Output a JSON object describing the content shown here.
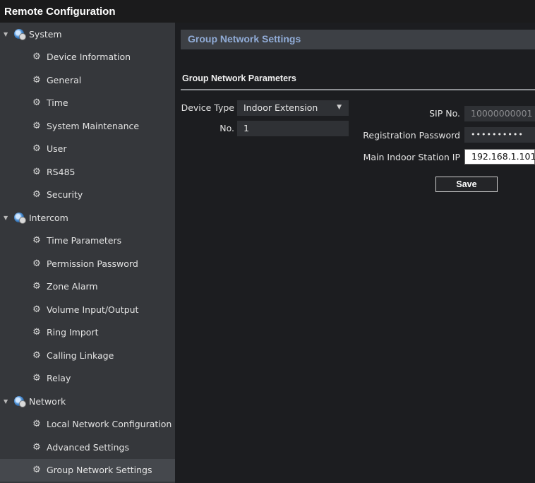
{
  "window": {
    "title": "Remote Configuration"
  },
  "sidebar": {
    "items": [
      {
        "kind": "group",
        "label": "System",
        "icon": "globe-settings-icon"
      },
      {
        "kind": "child",
        "label": "Device Information",
        "icon": "gear-icon"
      },
      {
        "kind": "child",
        "label": "General",
        "icon": "gear-icon"
      },
      {
        "kind": "child",
        "label": "Time",
        "icon": "gear-icon"
      },
      {
        "kind": "child",
        "label": "System Maintenance",
        "icon": "gear-icon"
      },
      {
        "kind": "child",
        "label": "User",
        "icon": "gear-icon"
      },
      {
        "kind": "child",
        "label": "RS485",
        "icon": "gear-icon"
      },
      {
        "kind": "child",
        "label": "Security",
        "icon": "gear-icon"
      },
      {
        "kind": "group",
        "label": "Intercom",
        "icon": "globe-settings-icon"
      },
      {
        "kind": "child",
        "label": "Time Parameters",
        "icon": "gear-icon"
      },
      {
        "kind": "child",
        "label": "Permission Password",
        "icon": "gear-icon"
      },
      {
        "kind": "child",
        "label": "Zone Alarm",
        "icon": "gear-icon"
      },
      {
        "kind": "child",
        "label": "Volume Input/Output",
        "icon": "gear-icon"
      },
      {
        "kind": "child",
        "label": "Ring Import",
        "icon": "gear-icon"
      },
      {
        "kind": "child",
        "label": "Calling Linkage",
        "icon": "gear-icon"
      },
      {
        "kind": "child",
        "label": "Relay",
        "icon": "gear-icon"
      },
      {
        "kind": "group",
        "label": "Network",
        "icon": "globe-settings-icon"
      },
      {
        "kind": "child",
        "label": "Local Network Configuration",
        "icon": "gear-icon"
      },
      {
        "kind": "child",
        "label": "Advanced Settings",
        "icon": "gear-icon"
      },
      {
        "kind": "child",
        "label": "Group Network Settings",
        "icon": "gear-icon",
        "selected": true
      }
    ]
  },
  "main": {
    "section_title": "Group Network Settings",
    "subsection_title": "Group Network Parameters",
    "fields": {
      "device_type": {
        "label": "Device Type",
        "value": "Indoor Extension"
      },
      "no": {
        "label": "No.",
        "value": "1"
      },
      "sip_no": {
        "label": "SIP No.",
        "value": "10000000001"
      },
      "registration_password": {
        "label": "Registration Password",
        "value": "••••••••••"
      },
      "main_indoor_station_ip": {
        "label": "Main Indoor Station IP",
        "value": "192.168.1.101"
      }
    },
    "save_label": "Save"
  }
}
